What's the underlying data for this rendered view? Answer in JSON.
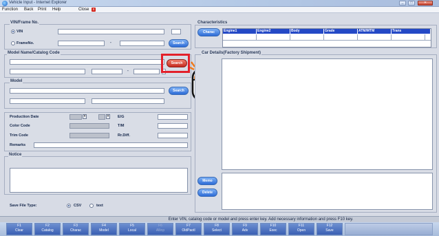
{
  "window": {
    "title": "Vehicle Input - Internet Explorer"
  },
  "menu": {
    "items": [
      "Function",
      "Back",
      "Print",
      "Help",
      "Close"
    ],
    "close_glyph": "x"
  },
  "vin_frame": {
    "legend": "VIN/Frame No.",
    "vin_label": "VIN",
    "frame_label": "FrameNo.",
    "dash": "-",
    "search": "Search"
  },
  "model_name": {
    "legend": "Model Name/Catalog Code",
    "dash": "-",
    "search": "Search"
  },
  "model": {
    "legend": "Model",
    "search": "Search"
  },
  "production": {
    "labels": [
      "Production Date",
      "Color Code",
      "Trim Code",
      "Remarks"
    ],
    "right_labels": [
      "E/G",
      "T/M",
      "Rr.Diff."
    ]
  },
  "notice": {
    "legend": "Notice"
  },
  "save": {
    "label": "Save File Type:",
    "options": [
      "CSV",
      "text"
    ],
    "selected": "CSV"
  },
  "characteristics": {
    "legend": "Characteristics",
    "charac_button": "Charac",
    "headers": [
      "Engine1",
      "Engine2",
      "Body",
      "Grade",
      "ATM/MTM",
      "Trans"
    ],
    "header_color": "#2449c6"
  },
  "car_details": {
    "legend": "Car Details(Factory Shipment)"
  },
  "side_buttons": [
    "Memo",
    "Delete"
  ],
  "status_bar": {
    "text": "Enter VIN, catalog code or model and press enter key. Add necessary information and press F10 key."
  },
  "function_keys": [
    {
      "key": "F1",
      "label": "Clear",
      "enabled": true
    },
    {
      "key": "F2",
      "label": "Catalog",
      "enabled": true
    },
    {
      "key": "F3",
      "label": "Charac",
      "enabled": true
    },
    {
      "key": "F4",
      "label": "Model",
      "enabled": true
    },
    {
      "key": "F5",
      "label": "Local",
      "enabled": true
    },
    {
      "key": "F6",
      "label": "Allinp",
      "enabled": false
    },
    {
      "key": "F7",
      "label": "OldPaotl",
      "enabled": true
    },
    {
      "key": "F8",
      "label": "Select",
      "enabled": true
    },
    {
      "key": "F9",
      "label": "Adv",
      "enabled": true
    },
    {
      "key": "F10",
      "label": "Exec",
      "enabled": true
    },
    {
      "key": "F11",
      "label": "Open",
      "enabled": true
    },
    {
      "key": "F12",
      "label": "Save",
      "enabled": true
    }
  ],
  "colors": {
    "accent": "#2d6bd6",
    "highlight": "#e3202a",
    "pointer_orange": "#f07a1a"
  }
}
